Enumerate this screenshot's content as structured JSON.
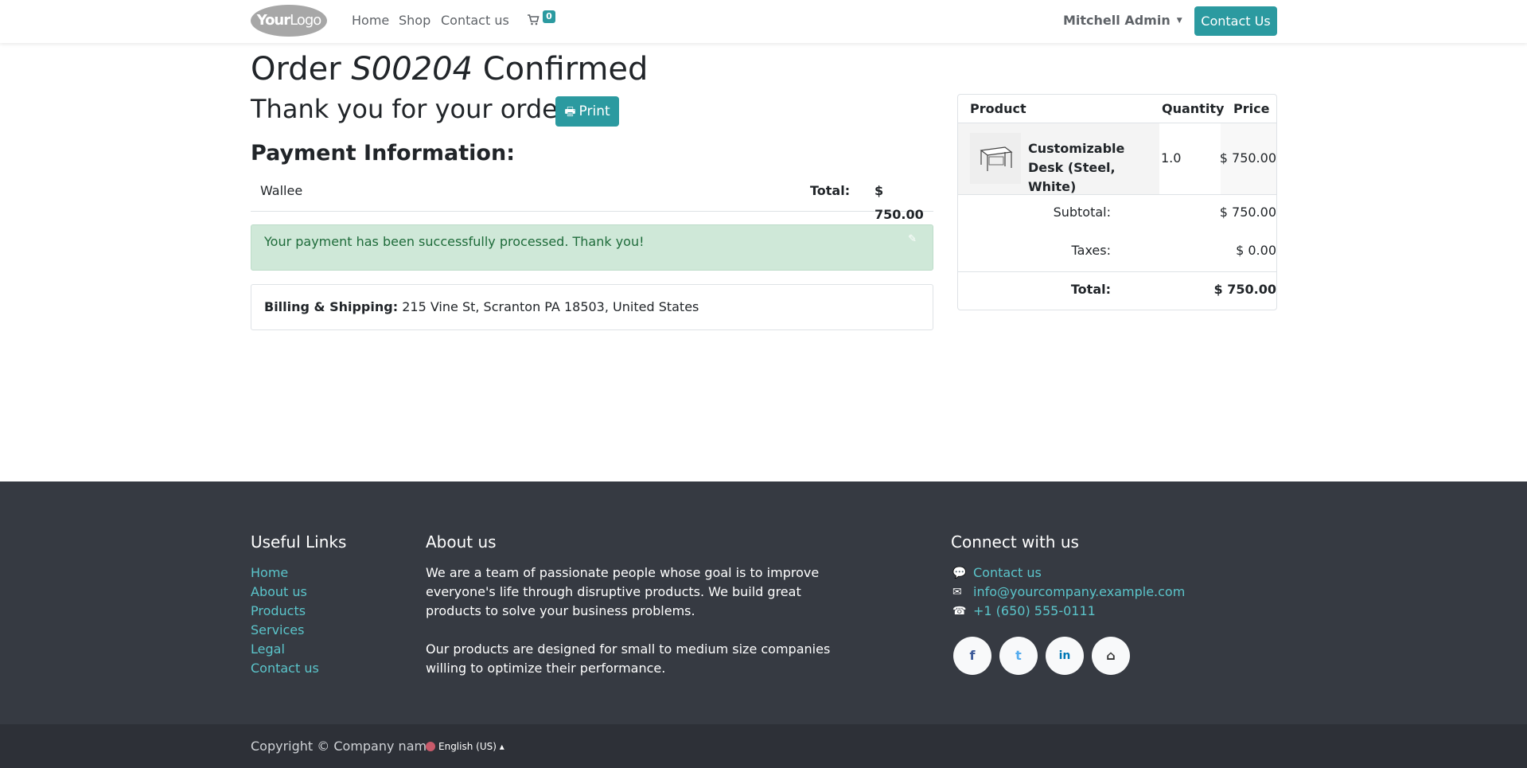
{
  "header": {
    "logo": {
      "bold": "Your",
      "light": "Logo"
    },
    "nav": [
      "Home",
      "Shop",
      "Contact us"
    ],
    "cart_count": "0",
    "user": "Mitchell Admin",
    "contact_button": "Contact Us"
  },
  "order": {
    "title_prefix": "Order",
    "order_ref": "S00204",
    "title_suffix": "Confirmed",
    "thank_you": "Thank you for your order.",
    "print_label": "Print"
  },
  "payment": {
    "heading": "Payment Information:",
    "method": "Wallee",
    "total_label": "Total:",
    "total_value": "$ 750.00",
    "success_message": "Your payment has been successfully processed. Thank you!"
  },
  "address": {
    "label": "Billing & Shipping:",
    "value": "215 Vine St, Scranton PA 18503, United States"
  },
  "summary": {
    "columns": [
      "Product",
      "Quantity",
      "Price"
    ],
    "item": {
      "name": "Customizable Desk (Steel, White)",
      "quantity": "1.0",
      "price": "$ 750.00"
    },
    "subtotal_label": "Subtotal:",
    "subtotal_value": "$ 750.00",
    "taxes_label": "Taxes:",
    "taxes_value": "$ 0.00",
    "total_label": "Total:",
    "total_value": "$ 750.00"
  },
  "footer": {
    "useful_links_heading": "Useful Links",
    "useful_links": [
      "Home",
      "About us",
      "Products",
      "Services",
      "Legal",
      "Contact us"
    ],
    "about_heading": "About us",
    "about_text_1": "We are a team of passionate people whose goal is to improve everyone's life through disruptive products. We build great products to solve your business problems.",
    "about_text_2": "Our products are designed for small to medium size companies willing to optimize their performance.",
    "connect_heading": "Connect with us",
    "connect_items": [
      {
        "icon": "comment-icon",
        "label": "Contact us"
      },
      {
        "icon": "envelope-icon",
        "label": "info@yourcompany.example.com"
      },
      {
        "icon": "phone-icon",
        "label": "+1 (650) 555-0111"
      }
    ],
    "social": [
      {
        "icon": "facebook-icon",
        "glyph": "f",
        "color": "#3b5998"
      },
      {
        "icon": "twitter-icon",
        "glyph": "t",
        "color": "#55acee"
      },
      {
        "icon": "linkedin-icon",
        "glyph": "in",
        "color": "#0077b5"
      },
      {
        "icon": "home-icon",
        "glyph": "⌂",
        "color": "#333333"
      }
    ],
    "copyright": "Copyright © Company name",
    "language": "English (US)"
  },
  "colors": {
    "primary": "#2b9aa0",
    "footer_bg": "#363a42",
    "footer_link": "#5bc5cb",
    "success_bg": "#cfe8d8"
  }
}
